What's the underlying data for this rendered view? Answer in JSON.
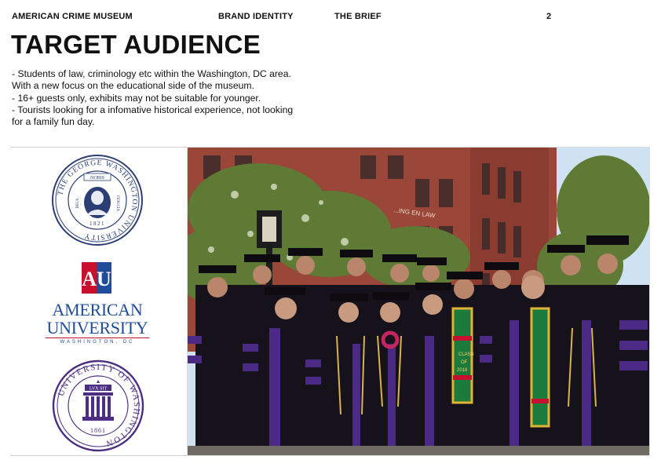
{
  "header": {
    "museum": "AMERICAN CRIME MUSEUM",
    "section": "BRAND IDENTITY",
    "subsection": "THE BRIEF",
    "page_number": "2"
  },
  "title": "TARGET AUDIENCE",
  "bullets": [
    "- Students of law, criminology etc within the Washington, DC area.",
    "With a new focus on the educational side of the museum.",
    "- 16+ guests only, exhibits may not be suitable for younger.",
    "- Tourists looking for a infomative historical experience, not looking",
    "for a family fun day."
  ],
  "logos": {
    "gwu": {
      "ring_text": "THE GEORGE WASHINGTON UNIVERSITY",
      "year": "1821",
      "left": "DEUS",
      "right": "FIDUCIA",
      "top": "NOBIS"
    },
    "au": {
      "line1": "AMERICAN",
      "line2": "UNIVERSITY",
      "line3": "WASHINGTON, DC",
      "monogram": "AU"
    },
    "uw": {
      "ring_text": "UNIVERSITY OF WASHINGTON",
      "year": "1861",
      "motto": "LVX SIT"
    }
  },
  "photo": {
    "sign_text": "...ING EN LAW",
    "stole_labels": [
      "CLASS",
      "OF",
      "2018"
    ],
    "colors": {
      "robe": "#16121c",
      "velvet": "#4b2a86",
      "brick": "#9a4638",
      "foliage": "#5e7a35",
      "sky": "#cfe2f1",
      "seal_blue": "#2c3f75",
      "uw_purple": "#4b2e83",
      "au_red": "#c8102e",
      "au_blue": "#1f4d9a"
    }
  }
}
